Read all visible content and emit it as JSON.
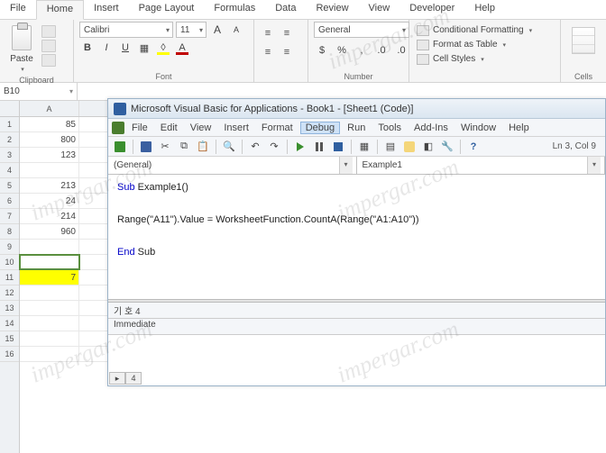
{
  "ribbon": {
    "tabs": [
      "File",
      "Home",
      "Insert",
      "Page Layout",
      "Formulas",
      "Data",
      "Review",
      "View",
      "Developer",
      "Help"
    ],
    "active_tab": 1,
    "clipboard": {
      "label": "Clipboard",
      "paste": "Paste"
    },
    "font": {
      "label": "Font",
      "name": "Calibri",
      "size": "11",
      "bold": "B",
      "italic": "I",
      "underline": "U",
      "grow": "A",
      "shrink": "A"
    },
    "number": {
      "label": "Number",
      "format": "General"
    },
    "styles": {
      "cond": "Conditional Formatting",
      "table": "Format as Table",
      "cell": "Cell Styles"
    },
    "cells": {
      "label": "Cells"
    }
  },
  "namebox": "B10",
  "sheet": {
    "col_header": "A",
    "rows": [
      "85",
      "800",
      "123",
      "",
      "213",
      "24",
      "214",
      "960",
      "",
      "",
      "7",
      "",
      "",
      "",
      "",
      ""
    ],
    "selected_row": 10,
    "highlight_row": 11
  },
  "vba": {
    "title": "Microsoft Visual Basic for Applications - Book1 - [Sheet1 (Code)]",
    "menu": [
      "File",
      "Edit",
      "View",
      "Insert",
      "Format",
      "Debug",
      "Run",
      "Tools",
      "Add-Ins",
      "Window",
      "Help"
    ],
    "menu_active": 5,
    "status": "Ln 3, Col 9",
    "combo_left": "(General)",
    "combo_right": "Example1",
    "code": {
      "l1a": "Sub",
      "l1b": " Example1()",
      "l2": "Range(\"A11\").Value = WorksheetFunction.CountA(Range(\"A1:A10\"))",
      "l3a": "End",
      "l3b": " Sub"
    },
    "pane_header": "기 호 4",
    "immediate_label": "Immediate",
    "bottom_tab": "4"
  },
  "watermark": "impergar.com"
}
